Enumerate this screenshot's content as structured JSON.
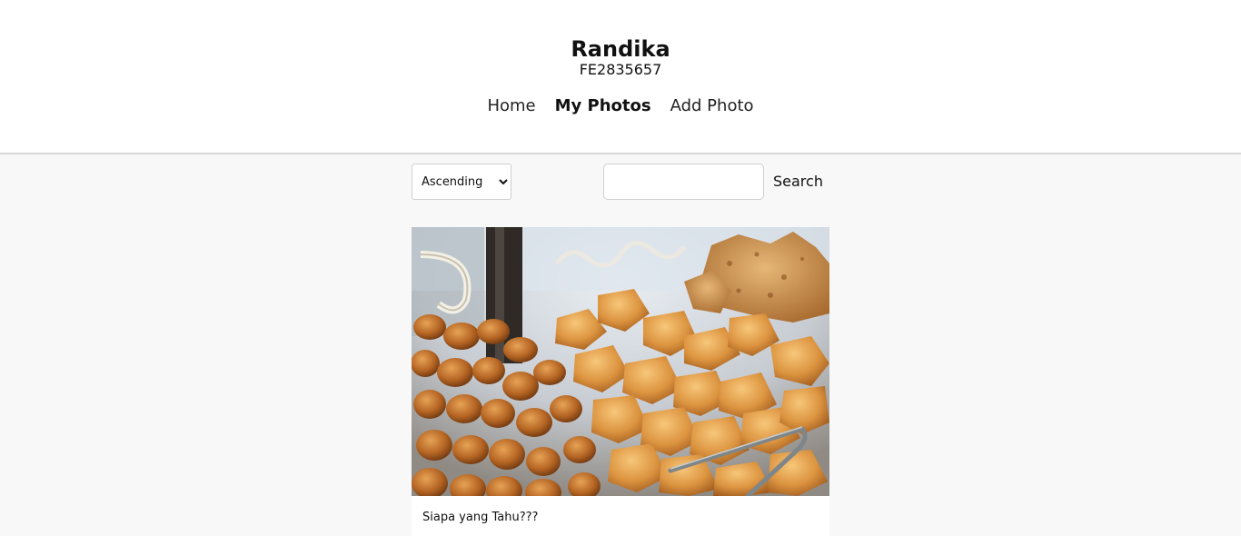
{
  "header": {
    "name": "Randika",
    "user_id": "FE2835657"
  },
  "nav": {
    "items": [
      {
        "label": "Home"
      },
      {
        "label": "My Photos"
      },
      {
        "label": "Add Photo"
      }
    ],
    "active": "My Photos"
  },
  "toolbar": {
    "sort": {
      "selected": "Ascending",
      "options": [
        "Ascending"
      ]
    },
    "search": {
      "value": "",
      "placeholder": "",
      "button_label": "Search"
    }
  },
  "photos": [
    {
      "caption": "Siapa yang Tahu???"
    }
  ]
}
